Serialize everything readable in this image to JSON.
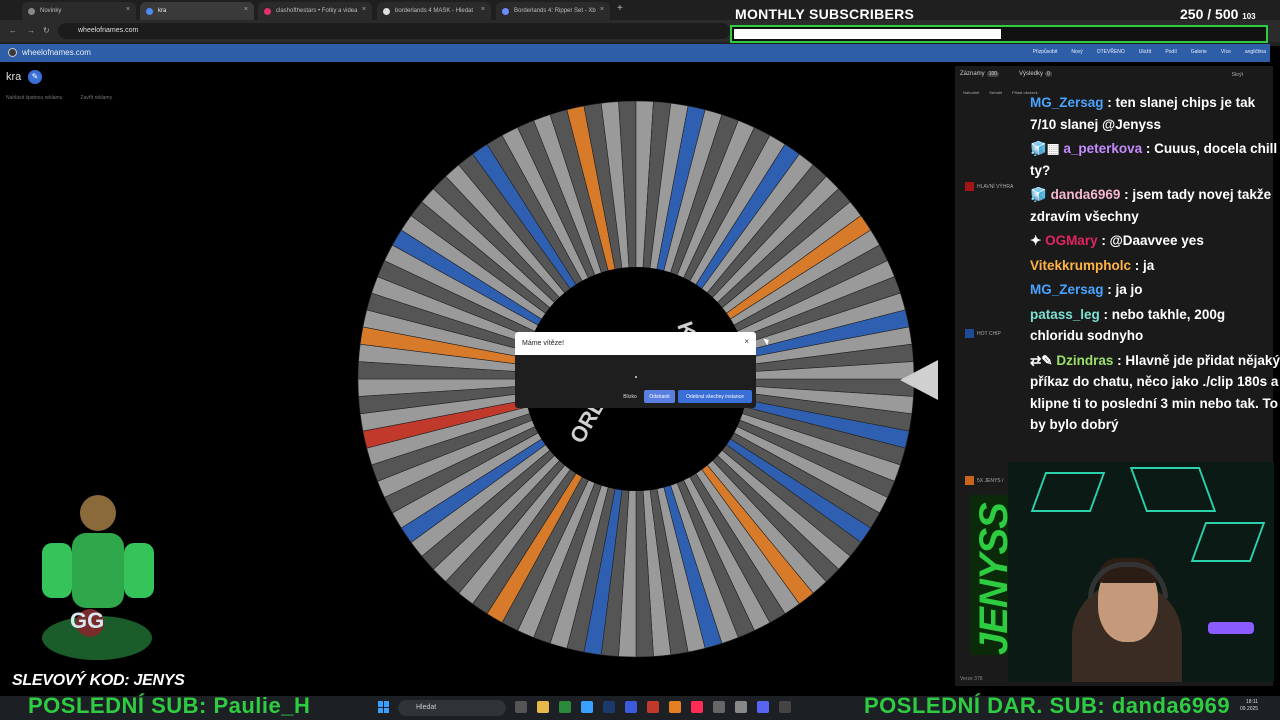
{
  "browser": {
    "tabs": [
      {
        "label": "Novinky",
        "active": false
      },
      {
        "label": "kra",
        "active": true
      },
      {
        "label": "clashofthestars • Fotky a videa",
        "active": false
      },
      {
        "label": "borderlands 4 MASK - Hledat",
        "active": false
      },
      {
        "label": "Borderlands 4: Ripper Set - Xb",
        "active": false
      }
    ],
    "url": "wheelofnames.com"
  },
  "overlay": {
    "subs_title": "MONTHLY SUBSCRIBERS",
    "subs_current": "250",
    "subs_goal": "/ 500",
    "subs_extra": "103",
    "subs_progress": 0.5,
    "last_sub_label": "POSLEDNÍ SUB: Paulie_H",
    "last_gift_label": "POSLEDNÍ DAR. SUB: danda6969",
    "promo_prefix": "SLEVOVÝ KOD:",
    "promo_code": "JENYS",
    "side_brand": "JENYSS"
  },
  "site": {
    "name": "wheelofnames.com",
    "menu": [
      "Přizpůsobit",
      "Nový",
      "OTEVŘENO",
      "Uložit",
      "Podíl",
      "Galerie",
      "Více",
      "angličtina"
    ],
    "wheel_title": "kra",
    "links": [
      "Nahlásit špatnou reklamu",
      "Zavřít reklamy"
    ]
  },
  "wheel": {
    "center_text_top": "KRO",
    "center_text_bottom": "ORLD",
    "colors": {
      "grey": "#9a9a9a",
      "blue": "#2f5fb0",
      "orange": "#d77a2a",
      "red": "#c0392b",
      "dark": "#555555"
    }
  },
  "dialog": {
    "title": "Máme vítěze!",
    "close_symbol": "×",
    "btn_close": "Blízko",
    "btn_remove": "Odstranit",
    "btn_remove_all": "Odebrat všechny instance"
  },
  "panel": {
    "tabs": [
      {
        "label": "Záznamy",
        "count": "100"
      },
      {
        "label": "Výsledky",
        "count": "0"
      }
    ],
    "hide_label": "Skrýt",
    "tools": [
      "Náhodně",
      "Seřadit",
      "Přidat obrázek"
    ],
    "entries": [
      {
        "label": "HLAVNÍ VÝHRA",
        "color": "#a31515"
      },
      {
        "label": "HOT CHIP",
        "color": "#1e4a9a"
      },
      {
        "label": "5X JENYS /",
        "color": "#c8641e"
      }
    ],
    "version": "Verze 378"
  },
  "chat": [
    {
      "user": "MG_Zersag",
      "color": "#4aa3ff",
      "text": ": ten slanej chips je tak 7/10 slanej @Jenyss",
      "badges": ""
    },
    {
      "user": "a_peterkova",
      "color": "#c58cff",
      "text": ": Cuuus, docela chill ty?",
      "badges": "🧊▦"
    },
    {
      "user": "danda6969",
      "color": "#f4b6d0",
      "text": ": jsem tady novej takže zdravím všechny",
      "badges": "🧊"
    },
    {
      "user": "OGMary",
      "color": "#e0245e",
      "text": ": @Daavvee yes",
      "badges": "✦"
    },
    {
      "user": "Vitekkrumpholc",
      "color": "#ffb347",
      "text": ": ja",
      "badges": ""
    },
    {
      "user": "MG_Zersag",
      "color": "#4aa3ff",
      "text": ": ja jo",
      "badges": ""
    },
    {
      "user": "patass_leg",
      "color": "#7ee0d2",
      "text": ": nebo takhle, 200g chloridu sodnyho",
      "badges": ""
    },
    {
      "user": "Dzindras",
      "color": "#9be16a",
      "text": ": Hlavně jde přidat nějaký příkaz do chatu, něco jako ./clip 180s a klipne ti to poslední 3 min nebo tak. To by bylo dobrý",
      "badges": "⇄✎"
    }
  ],
  "taskbar": {
    "search_placeholder": "Hledat",
    "time": "18:11",
    "date": "09.2025"
  }
}
